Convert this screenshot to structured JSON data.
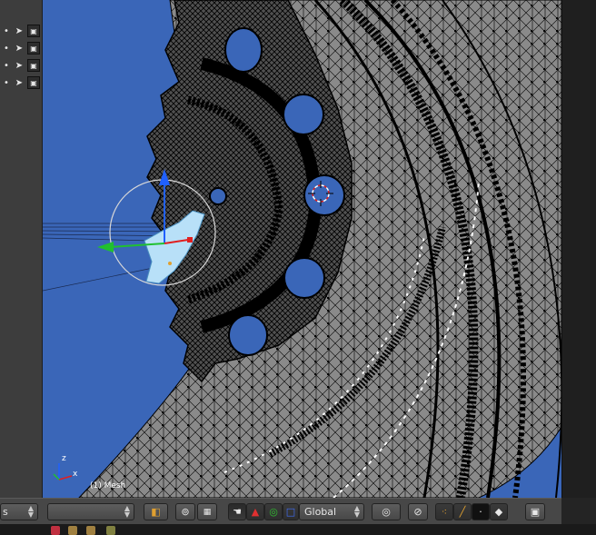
{
  "outliner": {
    "rows": [
      {
        "cursor_icon": "cursor-arrow-icon",
        "render_icon": "render-icon"
      },
      {
        "cursor_icon": "cursor-arrow-icon",
        "render_icon": "render-icon"
      },
      {
        "cursor_icon": "cursor-arrow-icon",
        "render_icon": "render-icon"
      },
      {
        "cursor_icon": "cursor-arrow-icon",
        "render_icon": "render-icon"
      }
    ]
  },
  "viewport": {
    "object_label": "(1) Mesh",
    "axis_labels": {
      "z": "z",
      "x": "x"
    },
    "colors": {
      "background": "#3a66b8",
      "mesh_fill": "#8a8a8a",
      "wire": "#000000",
      "selection": "#b8e0f8",
      "widget_ring": "#d8d8d8",
      "axis_x": "#e02020",
      "axis_y": "#20c030",
      "axis_z": "#2060ff"
    }
  },
  "header": {
    "left_selector_label": "s",
    "transform_orientation": "Global",
    "icons": [
      "object-mode-icon",
      "pivot-icon",
      "layers-icon",
      "hand-icon",
      "translate-icon",
      "rotate-icon",
      "scale-icon",
      "proportional-edit-icon",
      "snap-icon",
      "vertex-select-icon",
      "edge-select-icon",
      "face-select-icon",
      "occlude-icon",
      "render-preview-icon"
    ]
  }
}
